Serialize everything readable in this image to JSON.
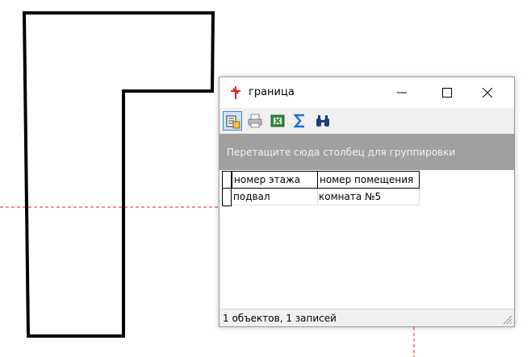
{
  "window": {
    "title": "граница",
    "icon": "red-pin-icon",
    "controls": [
      "minimize-icon",
      "maximize-icon",
      "close-icon"
    ]
  },
  "toolbar": {
    "tools": [
      {
        "name": "select-records-icon",
        "active": true
      },
      {
        "name": "print-icon",
        "active": false
      },
      {
        "name": "excel-export-icon",
        "active": false
      },
      {
        "name": "sum-icon",
        "active": false
      },
      {
        "name": "binoculars-icon",
        "active": false
      }
    ]
  },
  "group_panel": {
    "text": "Перетащите сюда столбец для группировки"
  },
  "grid": {
    "columns": [
      "номер этажа",
      "номер помещения"
    ],
    "rows": [
      [
        "подвал",
        "комната №5"
      ]
    ]
  },
  "status": {
    "text": "1 объектов, 1 записей"
  },
  "colors": {
    "accent_red": "#e02020",
    "group_bar": "#a0a0a0",
    "toolbar_bg": "#f0f0f0"
  }
}
